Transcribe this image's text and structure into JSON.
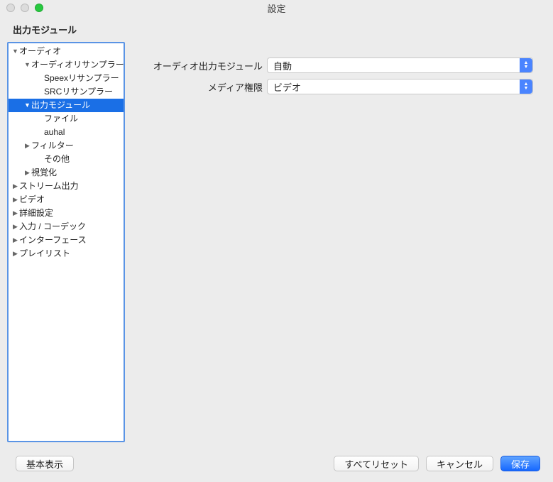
{
  "window": {
    "title": "設定"
  },
  "section_title": "出力モジュール",
  "sidebar": [
    {
      "label": "オーディオ",
      "indent": 0,
      "arrow": "expanded",
      "selected": false,
      "name": "tree-audio"
    },
    {
      "label": "オーディオリサンプラー",
      "indent": 1,
      "arrow": "expanded",
      "selected": false,
      "name": "tree-audio-resampler"
    },
    {
      "label": "Speexリサンプラー",
      "indent": 2,
      "arrow": "none",
      "selected": false,
      "name": "tree-speex-resampler"
    },
    {
      "label": "SRCリサンプラー",
      "indent": 2,
      "arrow": "none",
      "selected": false,
      "name": "tree-src-resampler"
    },
    {
      "label": "出力モジュール",
      "indent": 1,
      "arrow": "expanded",
      "selected": true,
      "name": "tree-output-modules"
    },
    {
      "label": "ファイル",
      "indent": 2,
      "arrow": "none",
      "selected": false,
      "name": "tree-file"
    },
    {
      "label": "auhal",
      "indent": 2,
      "arrow": "none",
      "selected": false,
      "name": "tree-auhal"
    },
    {
      "label": "フィルター",
      "indent": 1,
      "arrow": "collapsed",
      "selected": false,
      "name": "tree-filters"
    },
    {
      "label": "その他",
      "indent": 2,
      "arrow": "none",
      "selected": false,
      "name": "tree-other"
    },
    {
      "label": "視覚化",
      "indent": 1,
      "arrow": "collapsed",
      "selected": false,
      "name": "tree-visualization"
    },
    {
      "label": "ストリーム出力",
      "indent": 0,
      "arrow": "collapsed",
      "selected": false,
      "name": "tree-stream-output"
    },
    {
      "label": "ビデオ",
      "indent": 0,
      "arrow": "collapsed",
      "selected": false,
      "name": "tree-video"
    },
    {
      "label": "詳細設定",
      "indent": 0,
      "arrow": "collapsed",
      "selected": false,
      "name": "tree-advanced"
    },
    {
      "label": "入力 / コーデック",
      "indent": 0,
      "arrow": "collapsed",
      "selected": false,
      "name": "tree-input-codecs"
    },
    {
      "label": "インターフェース",
      "indent": 0,
      "arrow": "collapsed",
      "selected": false,
      "name": "tree-interface"
    },
    {
      "label": "プレイリスト",
      "indent": 0,
      "arrow": "collapsed",
      "selected": false,
      "name": "tree-playlist"
    }
  ],
  "form": {
    "audio_output_module": {
      "label": "オーディオ出力モジュール",
      "value": "自動"
    },
    "media_permission": {
      "label": "メディア権限",
      "value": "ビデオ"
    }
  },
  "buttons": {
    "basic_view": "基本表示",
    "reset_all": "すべてリセット",
    "cancel": "キャンセル",
    "save": "保存"
  }
}
